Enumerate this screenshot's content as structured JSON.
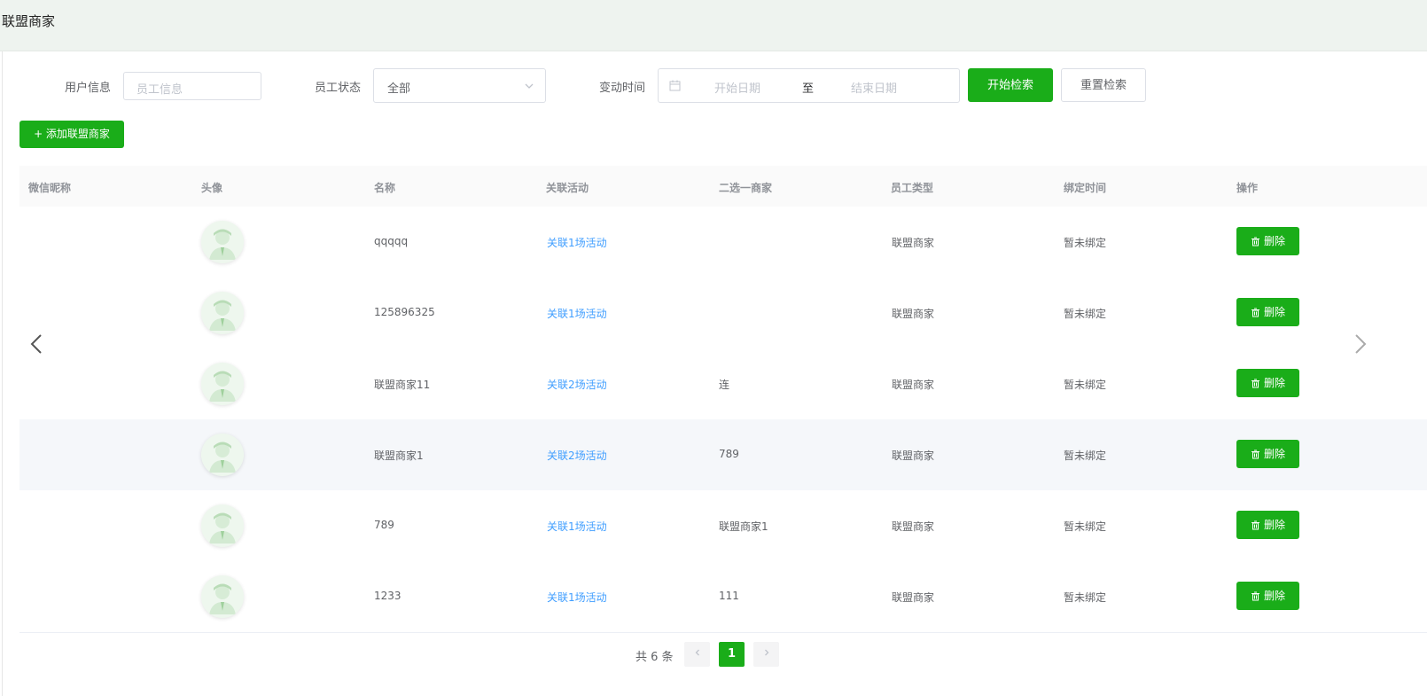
{
  "page": {
    "title": "联盟商家"
  },
  "filters": {
    "user_info_label": "用户信息",
    "user_info_placeholder": "员工信息",
    "status_label": "员工状态",
    "status_value": "全部",
    "time_label": "变动时间",
    "start_placeholder": "开始日期",
    "range_sep": "至",
    "end_placeholder": "结束日期",
    "search_button": "开始检索",
    "reset_button": "重置检索"
  },
  "add_button": "+ 添加联盟商家",
  "table": {
    "headers": [
      "微信昵称",
      "头像",
      "名称",
      "关联活动",
      "二选一商家",
      "员工类型",
      "绑定时间",
      "操作"
    ],
    "delete_label": "删除",
    "rows": [
      {
        "nickname": "",
        "name": "qqqqq",
        "activity": "关联1场活动",
        "partner": "",
        "type": "联盟商家",
        "bind_time": "暂未绑定"
      },
      {
        "nickname": "",
        "name": "125896325",
        "activity": "关联1场活动",
        "partner": "",
        "type": "联盟商家",
        "bind_time": "暂未绑定"
      },
      {
        "nickname": "",
        "name": "联盟商家11",
        "activity": "关联2场活动",
        "partner": "连",
        "type": "联盟商家",
        "bind_time": "暂未绑定"
      },
      {
        "nickname": "",
        "name": "联盟商家1",
        "activity": "关联2场活动",
        "partner": "789",
        "type": "联盟商家",
        "bind_time": "暂未绑定"
      },
      {
        "nickname": "",
        "name": "789",
        "activity": "关联1场活动",
        "partner": "联盟商家1",
        "type": "联盟商家",
        "bind_time": "暂未绑定"
      },
      {
        "nickname": "",
        "name": "1233",
        "activity": "关联1场活动",
        "partner": "111",
        "type": "联盟商家",
        "bind_time": "暂未绑定"
      }
    ]
  },
  "pagination": {
    "total_text": "共 6 条",
    "current_page": "1"
  },
  "colors": {
    "accent": "#1aad19",
    "link": "#409eff",
    "header_bg": "#eef3ef"
  }
}
